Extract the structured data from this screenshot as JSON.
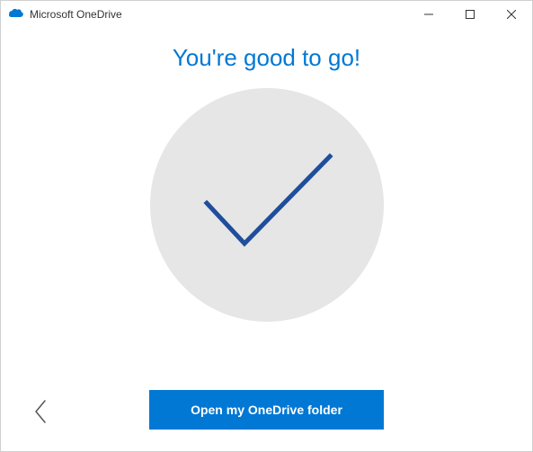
{
  "window": {
    "title": "Microsoft OneDrive"
  },
  "content": {
    "heading": "You're good to go!",
    "primary_button": "Open my OneDrive folder"
  },
  "icons": {
    "onedrive": "onedrive-icon",
    "checkmark": "checkmark-icon",
    "back": "back-chevron-icon",
    "minimize": "minimize-icon",
    "maximize": "maximize-icon",
    "close": "close-icon"
  },
  "colors": {
    "accent": "#0078d4",
    "circle_bg": "#e6e6e6",
    "check_stroke": "#1f4e9c"
  }
}
